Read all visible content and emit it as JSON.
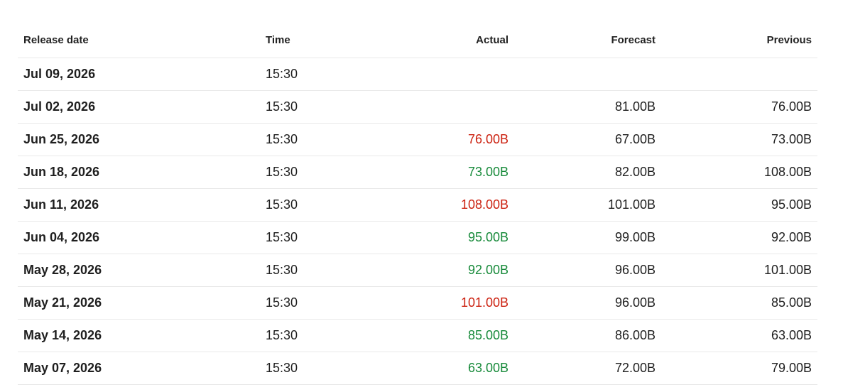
{
  "table": {
    "headers": {
      "release_date": "Release date",
      "time": "Time",
      "actual": "Actual",
      "forecast": "Forecast",
      "previous": "Previous"
    },
    "rows": [
      {
        "date": "Jul 09, 2026",
        "time": "15:30",
        "actual": "",
        "actual_trend": "",
        "forecast": "",
        "previous": ""
      },
      {
        "date": "Jul 02, 2026",
        "time": "15:30",
        "actual": "",
        "actual_trend": "",
        "forecast": "81.00B",
        "previous": "76.00B"
      },
      {
        "date": "Jun 25, 2026",
        "time": "15:30",
        "actual": "76.00B",
        "actual_trend": "negative",
        "forecast": "67.00B",
        "previous": "73.00B"
      },
      {
        "date": "Jun 18, 2026",
        "time": "15:30",
        "actual": "73.00B",
        "actual_trend": "positive",
        "forecast": "82.00B",
        "previous": "108.00B"
      },
      {
        "date": "Jun 11, 2026",
        "time": "15:30",
        "actual": "108.00B",
        "actual_trend": "negative",
        "forecast": "101.00B",
        "previous": "95.00B"
      },
      {
        "date": "Jun 04, 2026",
        "time": "15:30",
        "actual": "95.00B",
        "actual_trend": "positive",
        "forecast": "99.00B",
        "previous": "92.00B"
      },
      {
        "date": "May 28, 2026",
        "time": "15:30",
        "actual": "92.00B",
        "actual_trend": "positive",
        "forecast": "96.00B",
        "previous": "101.00B"
      },
      {
        "date": "May 21, 2026",
        "time": "15:30",
        "actual": "101.00B",
        "actual_trend": "negative",
        "forecast": "96.00B",
        "previous": "85.00B"
      },
      {
        "date": "May 14, 2026",
        "time": "15:30",
        "actual": "85.00B",
        "actual_trend": "positive",
        "forecast": "86.00B",
        "previous": "63.00B"
      },
      {
        "date": "May 07, 2026",
        "time": "15:30",
        "actual": "63.00B",
        "actual_trend": "positive",
        "forecast": "72.00B",
        "previous": "79.00B"
      }
    ]
  },
  "colors": {
    "negative": "#cc2211",
    "positive": "#178a3a",
    "text": "#1f1f1f",
    "border": "#e9e9e9"
  }
}
